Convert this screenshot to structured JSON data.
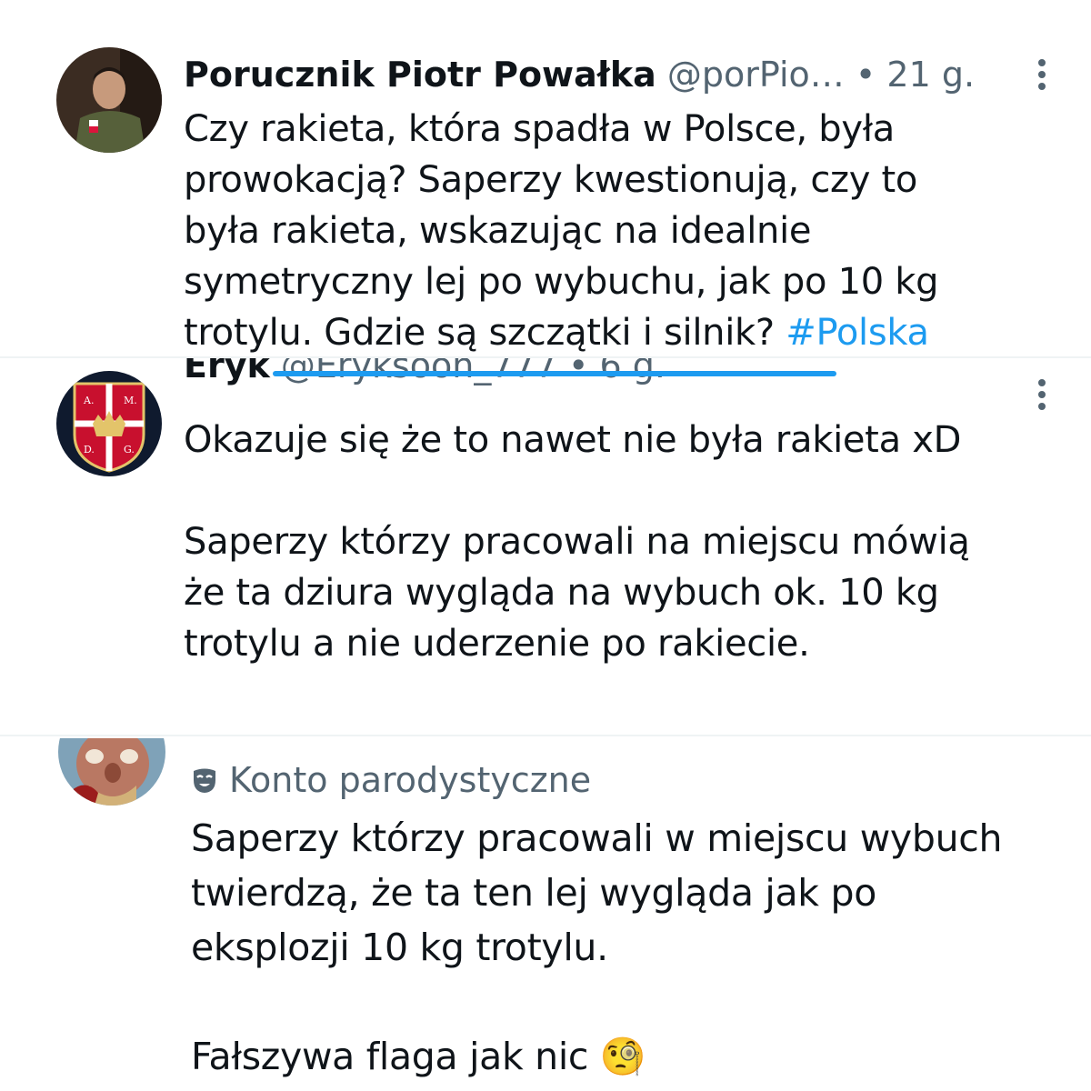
{
  "tweets": [
    {
      "author_name": "Porucznik Piotr Powałka",
      "handle": "@porPio…",
      "separator": "•",
      "time": "21 g.",
      "text_main": "Czy rakieta, która spadła w Polsce, była\nprowokacją? Saperzy kwestionują, czy to\nbyła rakieta, wskazując na idealnie\nsymetryczny lej po wybuchu, jak po 10 kg\ntrotylu. Gdzie są szczątki i silnik? ",
      "hashtag": "#Polska",
      "more_icon": "more-vertical-icon"
    },
    {
      "author_name": "Eryk",
      "handle": "@Eryksoon_777",
      "separator": "•",
      "time": "6 g.",
      "text": "Okazuje się że to nawet nie była rakieta xD\n\nSaperzy którzy pracowali na miejscu mówią\nże ta dziura wygląda na wybuch ok. 10 kg\ntrotylu a nie uderzenie po rakiecie.",
      "more_icon": "more-vertical-icon",
      "avatar_letters": [
        "A.",
        "M.",
        "D.",
        "G."
      ]
    },
    {
      "parody_label": "Konto parodystyczne",
      "parody_icon": "theater-mask-icon",
      "text": "Saperzy którzy pracowali w miejscu wybuch\ntwierdzą, że ta ten lej wygląda jak po\neksplozji 10 kg trotylu.\n\nFałszywa flaga jak nic ",
      "emoji": "🧐"
    }
  ],
  "colors": {
    "text": "#0f1419",
    "secondary": "#536471",
    "link": "#1d9bf0"
  }
}
